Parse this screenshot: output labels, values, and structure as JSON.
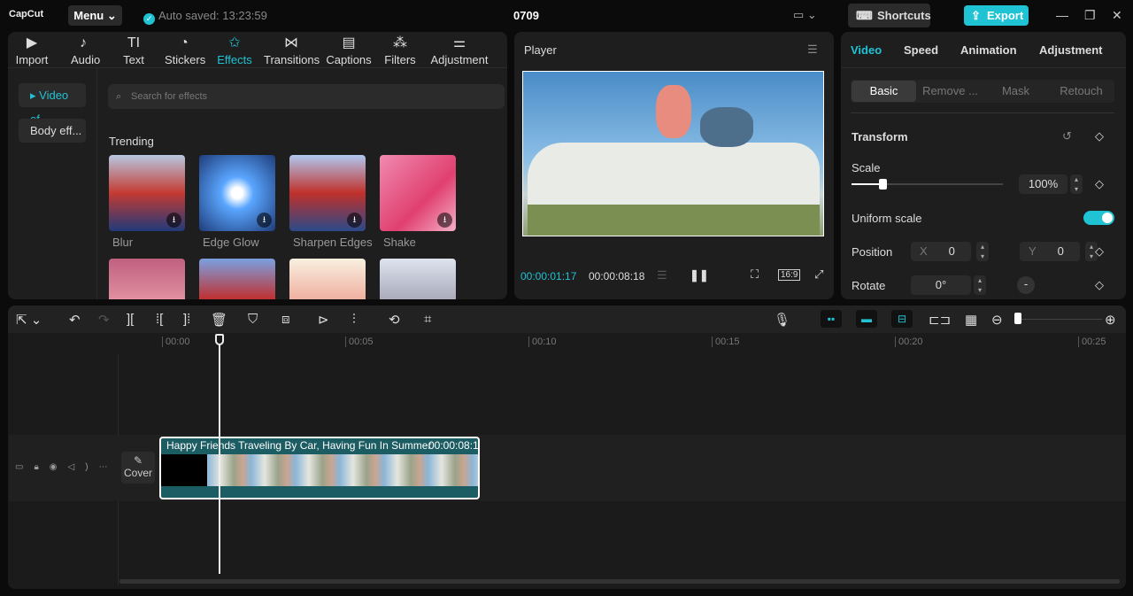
{
  "app": {
    "logo": "CapCut",
    "menu": "Menu",
    "autosave": "Auto saved: 13:23:59",
    "project": "0709",
    "shortcuts": "Shortcuts",
    "export": "Export"
  },
  "media_tabs": [
    {
      "label": "Import",
      "icon": "▶"
    },
    {
      "label": "Audio",
      "icon": "♪"
    },
    {
      "label": "Text",
      "icon": "TI"
    },
    {
      "label": "Stickers",
      "icon": "◔"
    },
    {
      "label": "Effects",
      "icon": "✩"
    },
    {
      "label": "Transitions",
      "icon": "⋈"
    },
    {
      "label": "Captions",
      "icon": "▤"
    },
    {
      "label": "Filters",
      "icon": "⁂"
    },
    {
      "label": "Adjustment",
      "icon": "⚌"
    }
  ],
  "effects": {
    "side": [
      "▸ Video ef...",
      "Body eff..."
    ],
    "search_placeholder": "Search for effects",
    "section": "Trending",
    "items": [
      "Blur",
      "Edge Glow",
      "Sharpen Edges",
      "Shake"
    ]
  },
  "player": {
    "title": "Player",
    "current": "00:00:01:17",
    "total": "00:00:08:18",
    "ratio": "16:9"
  },
  "inspector": {
    "tabs": [
      "Video",
      "Speed",
      "Animation",
      "Adjustment"
    ],
    "subtabs": [
      "Basic",
      "Remove ...",
      "Mask",
      "Retouch"
    ],
    "transform": "Transform",
    "scale_label": "Scale",
    "scale": "100%",
    "scale_value": 100,
    "uniform": "Uniform scale",
    "position": "Position",
    "x_label": "X",
    "x": "0",
    "y_label": "Y",
    "y": "0",
    "rotate": "Rotate",
    "rotate_val": "0°"
  },
  "timeline": {
    "ticks": [
      "00:00",
      "00:05",
      "00:10",
      "00:15",
      "00:20",
      "00:25"
    ],
    "clip_title": "Happy Friends Traveling By Car, Having Fun In Summer",
    "clip_duration": "00:00:08:1",
    "cover": "Cover"
  },
  "colors": {
    "accent": "#1fc3d3",
    "clip": "#1c5c63"
  }
}
